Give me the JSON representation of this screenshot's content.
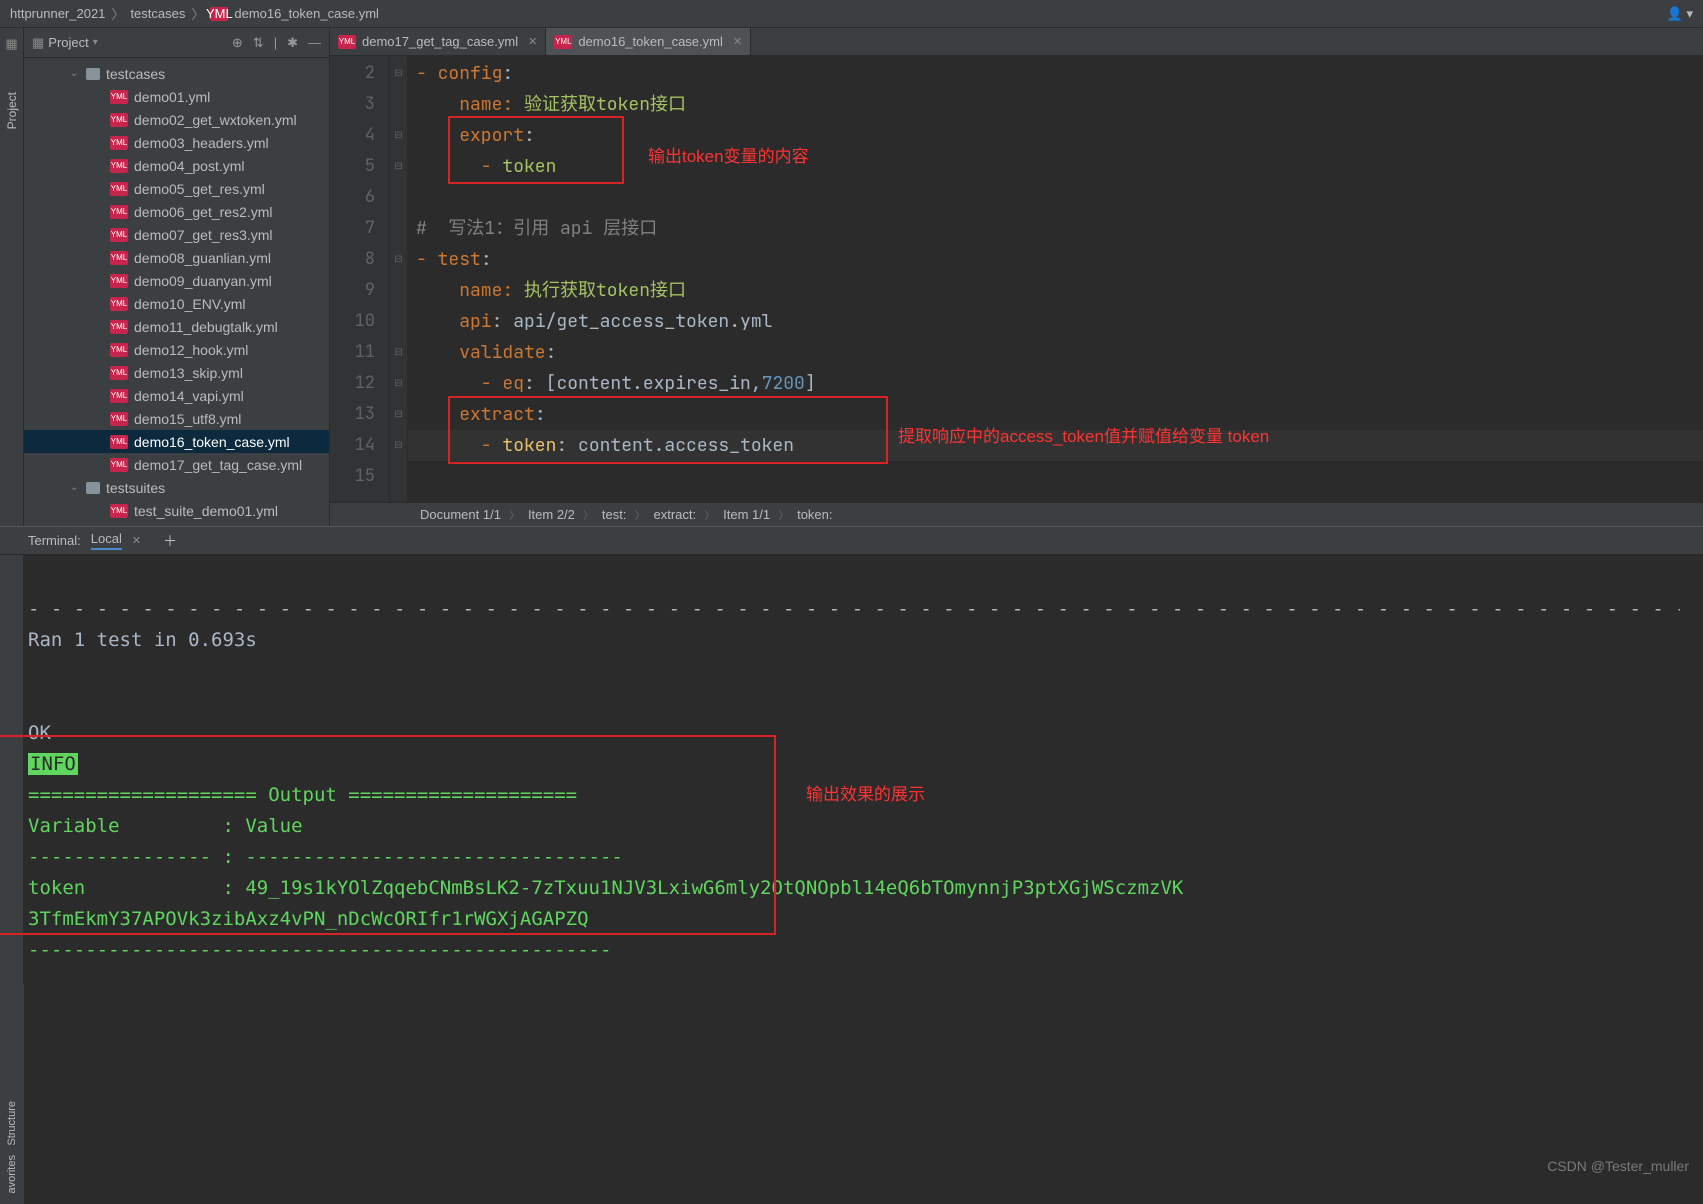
{
  "breadcrumb": {
    "root": "httprunner_2021",
    "folder": "testcases",
    "file": "demo16_token_case.yml"
  },
  "project": {
    "title": "Project",
    "tree": {
      "folder1": "testcases",
      "files": [
        "demo01.yml",
        "demo02_get_wxtoken.yml",
        "demo03_headers.yml",
        "demo04_post.yml",
        "demo05_get_res.yml",
        "demo06_get_res2.yml",
        "demo07_get_res3.yml",
        "demo08_guanlian.yml",
        "demo09_duanyan.yml",
        "demo10_ENV.yml",
        "demo11_debugtalk.yml",
        "demo12_hook.yml",
        "demo13_skip.yml",
        "demo14_vapi.yml",
        "demo15_utf8.yml",
        "demo16_token_case.yml",
        "demo17_get_tag_case.yml"
      ],
      "folder2": "testsuites",
      "file2": "test_suite_demo01.yml"
    }
  },
  "tabs": {
    "t1": "demo17_get_tag_case.yml",
    "t2": "demo16_token_case.yml"
  },
  "code": {
    "l2": "- config:",
    "l3_name": "    name: ",
    "l3_val": "验证获取token接口",
    "l4": "    export:",
    "l5": "      - token",
    "l7": "#  写法1：引用 api 层接口",
    "l8": "- test:",
    "l9_name": "    name: ",
    "l9_val": "执行获取token接口",
    "l10_api": "    api: ",
    "l10_val": "api/get_access_token.yml",
    "l11": "    validate:",
    "l12_a": "      - eq: ",
    "l12_b": "[content.expires_in,",
    "l12_c": "7200",
    "l12_d": "]",
    "l13": "    extract:",
    "l14_a": "      - token: ",
    "l14_b": "content.access_token"
  },
  "annotations": {
    "a1": "输出token变量的内容",
    "a2": "提取响应中的access_token值并赋值给变量 token",
    "a3": "输出效果的展示"
  },
  "bottom_crumb": {
    "c1": "Document 1/1",
    "c2": "Item 2/2",
    "c3": "test:",
    "c4": "extract:",
    "c5": "Item 1/1",
    "c6": "token:"
  },
  "terminal": {
    "tab_label": "Terminal:",
    "local": "Local",
    "dashes": "- - - - - - - - - - - - - - - - - - - - - - - - - - - - - - - - - - - - - - - - - - - - - - - - - - - - - - - - - - - - - - - - - - - - - - - - - - - - - - - - - - - - - - - -",
    "ran": "Ran 1 test in 0.693s",
    "ok": "OK",
    "info": "INFO",
    "output_hdr": "==================== Output ====================",
    "var_hdr": "Variable         : Value",
    "sep1": "---------------- : ---------------------------------",
    "token_line1": "token            : 49_19s1kYOlZqqebCNmBsLK2-7zTxuu1NJV3LxiwG6mly2OtQNOpbl14eQ6bTOmynnjP3ptXGjWSczmzVK",
    "token_line2": "3TfmEkmY37APOVk3zibAxz4vPN_nDcWcORIfr1rWGXjAGAPZQ",
    "sep2": "---------------------------------------------------"
  },
  "watermark": "CSDN @Tester_muller",
  "rails": {
    "project": "Project",
    "structure": "Structure",
    "favorites": "avorites"
  }
}
